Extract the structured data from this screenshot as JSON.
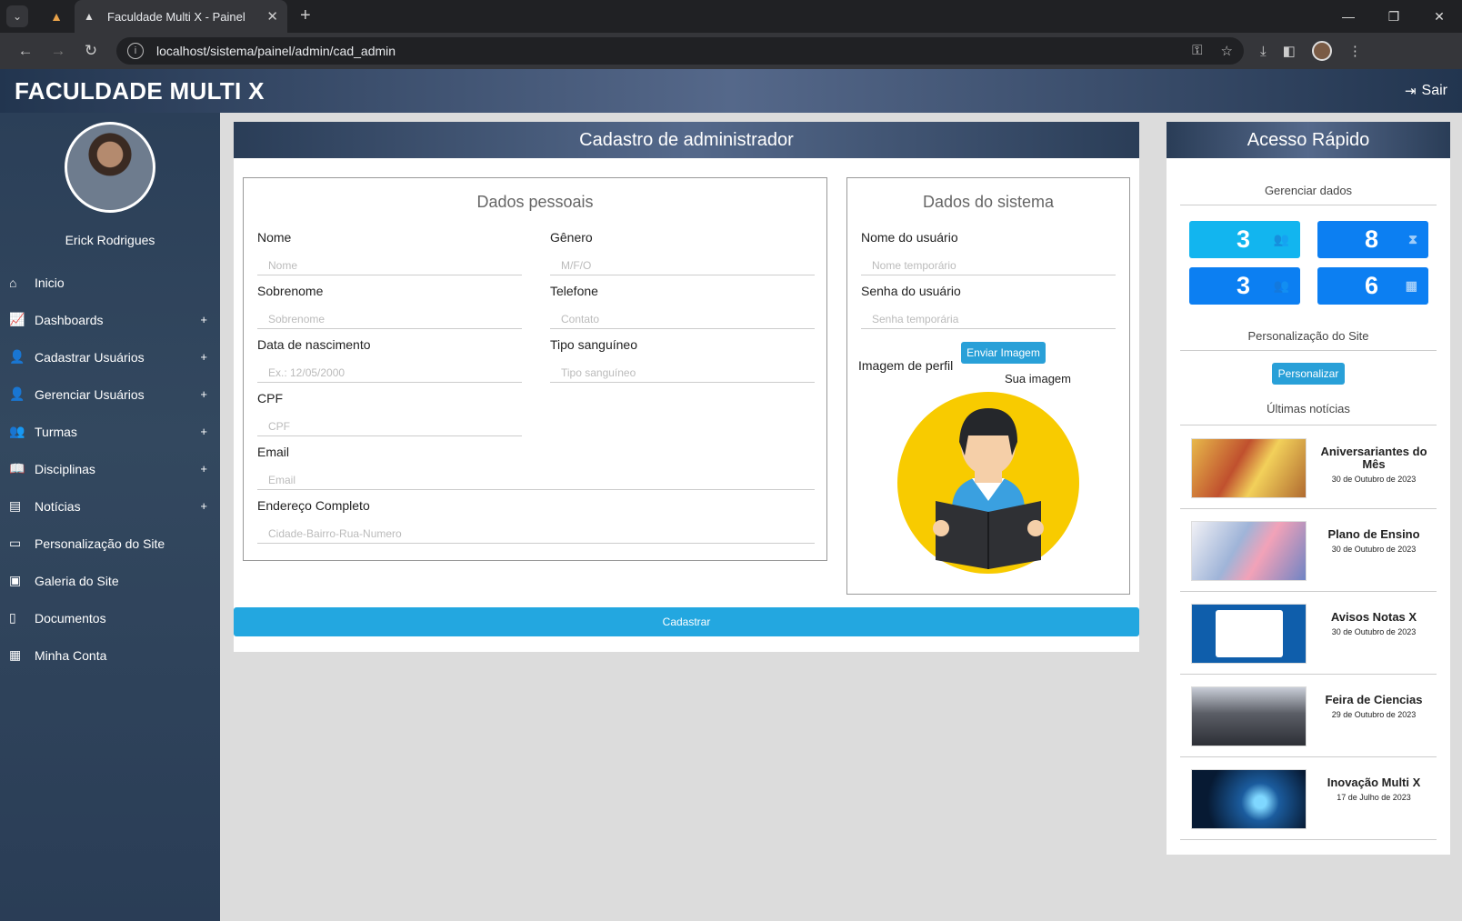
{
  "browser": {
    "tab_title": "Faculdade Multi X - Painel",
    "url": "localhost/sistema/painel/admin/cad_admin"
  },
  "header": {
    "brand": "FACULDADE MULTI X",
    "logout": "Sair"
  },
  "sidebar": {
    "user_name": "Erick Rodrigues",
    "items": [
      {
        "label": "Inicio",
        "icon": "home-icon",
        "expand": false
      },
      {
        "label": "Dashboards",
        "icon": "chart-line-icon",
        "expand": true
      },
      {
        "label": "Cadastrar Usuários",
        "icon": "user-plus-icon",
        "expand": true
      },
      {
        "label": "Gerenciar Usuários",
        "icon": "user-gear-icon",
        "expand": true
      },
      {
        "label": "Turmas",
        "icon": "users-icon",
        "expand": true
      },
      {
        "label": "Disciplinas",
        "icon": "book-icon",
        "expand": true
      },
      {
        "label": "Notícias",
        "icon": "newspaper-icon",
        "expand": true
      },
      {
        "label": "Personalização do Site",
        "icon": "laptop-icon",
        "expand": false
      },
      {
        "label": "Galeria do Site",
        "icon": "image-icon",
        "expand": false
      },
      {
        "label": "Documentos",
        "icon": "file-icon",
        "expand": false
      },
      {
        "label": "Minha Conta",
        "icon": "id-card-icon",
        "expand": false
      }
    ]
  },
  "form": {
    "title": "Cadastro de administrador",
    "personal_title": "Dados pessoais",
    "system_title": "Dados do sistema",
    "fields": {
      "nome": {
        "label": "Nome",
        "placeholder": "Nome"
      },
      "genero": {
        "label": "Gênero",
        "placeholder": "M/F/O"
      },
      "sobrenome": {
        "label": "Sobrenome",
        "placeholder": "Sobrenome"
      },
      "telefone": {
        "label": "Telefone",
        "placeholder": "Contato"
      },
      "nascimento": {
        "label": "Data de nascimento",
        "placeholder": "Ex.: 12/05/2000"
      },
      "sangue": {
        "label": "Tipo sanguíneo",
        "placeholder": "Tipo sanguíneo"
      },
      "cpf": {
        "label": "CPF",
        "placeholder": "CPF"
      },
      "email": {
        "label": "Email",
        "placeholder": "Email"
      },
      "endereco": {
        "label": "Endereço Completo",
        "placeholder": "Cidade-Bairro-Rua-Numero"
      },
      "usuario": {
        "label": "Nome do usuário",
        "placeholder": "Nome temporário"
      },
      "senha": {
        "label": "Senha do usuário",
        "placeholder": "Senha temporária"
      }
    },
    "profile_image_label": "Imagem de perfil",
    "upload_button": "Enviar Imagem",
    "your_image": "Sua imagem",
    "submit": "Cadastrar"
  },
  "quick": {
    "title": "Acesso Rápido",
    "manage_title": "Gerenciar dados",
    "tiles": [
      {
        "value": "3",
        "icon": "users-icon",
        "color": "#12b5ef"
      },
      {
        "value": "8",
        "icon": "hourglass-icon",
        "color": "#0c7ff2"
      },
      {
        "value": "3",
        "icon": "users-icon",
        "color": "#0c7ff2"
      },
      {
        "value": "6",
        "icon": "calendar-icon",
        "color": "#0c7ff2"
      }
    ],
    "custom_title": "Personalização do Site",
    "custom_button": "Personalizar",
    "news_title": "Últimas notícias",
    "news": [
      {
        "title": "Aniversariantes do Mês",
        "date": "30 de Outubro de 2023"
      },
      {
        "title": "Plano de Ensino",
        "date": "30 de Outubro de 2023"
      },
      {
        "title": "Avisos Notas X",
        "date": "30 de Outubro de 2023"
      },
      {
        "title": "Feira de Ciencias",
        "date": "29 de Outubro de 2023"
      },
      {
        "title": "Inovação Multi X",
        "date": "17 de Julho de 2023"
      }
    ]
  }
}
